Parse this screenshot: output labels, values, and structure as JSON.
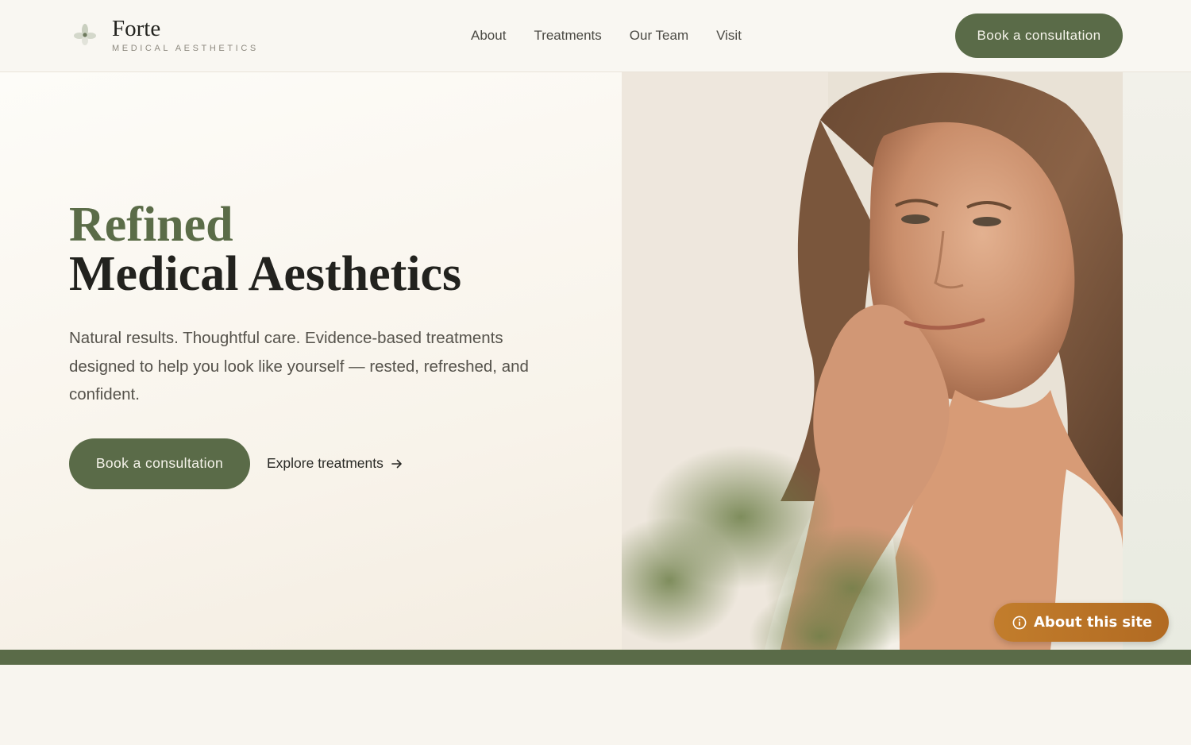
{
  "brand": {
    "name": "Forte",
    "tagline": "MEDICAL AESTHETICS",
    "mark_icon": "leaf-flower-icon"
  },
  "nav": {
    "items": [
      {
        "label": "About"
      },
      {
        "label": "Treatments"
      },
      {
        "label": "Our Team"
      },
      {
        "label": "Visit"
      }
    ]
  },
  "header": {
    "cta_label": "Book a consultation"
  },
  "hero": {
    "heading_accent": "Refined",
    "heading_main": "Medical Aesthetics",
    "lede": "Natural results. Thoughtful care. Evidence-based treatments designed to help you look like yourself — rested, refreshed, and confident.",
    "primary_cta": "Book a consultation",
    "secondary_cta": "Explore treatments",
    "secondary_icon": "arrow-right-icon",
    "image_alt": "Smiling woman resting her chin on her hand"
  },
  "about_badge": {
    "label": "About this site",
    "icon": "info-icon"
  },
  "colors": {
    "accent": "#5a6b48",
    "badge": "#b8722a",
    "background": "#f8f5ef"
  }
}
